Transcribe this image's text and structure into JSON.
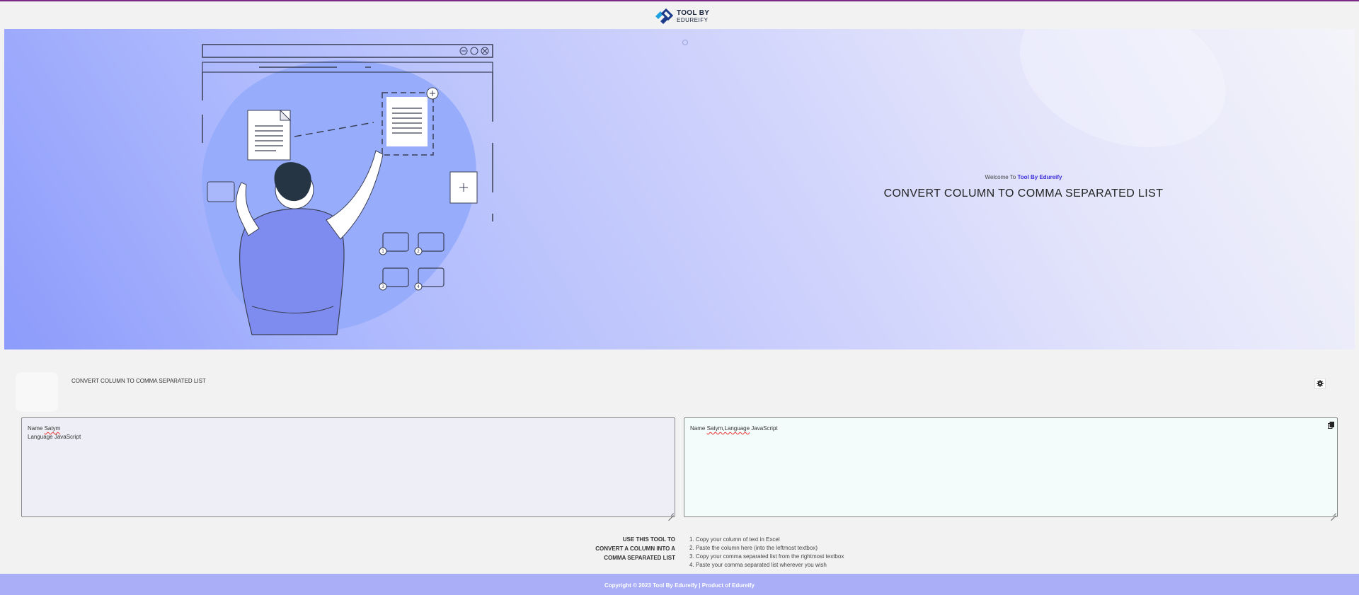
{
  "header": {
    "logo_line1": "TOOL BY",
    "logo_line2": "EDUREIFY"
  },
  "hero": {
    "welcome_prefix": "Welcome To ",
    "welcome_brand": "Tool By Edureify",
    "title": "CONVERT COLUMN TO COMMA SEPARATED LIST",
    "illustration_folder_numbers": [
      "1",
      "2",
      "3",
      "4"
    ]
  },
  "tool": {
    "section_label": "CONVERT COLUMN TO COMMA SEPARATED LIST",
    "input_line1_prefix": "Name ",
    "input_line1_word": "Satym",
    "input_line2": "Language JavaScript",
    "output_prefix": "Name ",
    "output_word": "Satym,Language",
    "output_suffix": " JavaScript",
    "settings_icon": "gear-icon",
    "copy_icon": "copy-icon"
  },
  "instructions": {
    "title_lines": [
      "USE THIS TOOL TO",
      "CONVERT A COLUMN INTO A",
      "COMMA SEPARATED LIST"
    ],
    "steps": [
      "1. Copy your column of text in Excel",
      "2. Paste the column here (into the leftmost textbox)",
      "3. Copy your comma separated list from the rightmost textbox",
      "4. Paste your comma separated list wherever you wish"
    ]
  },
  "footer": {
    "text": "Copyright © 2023 Tool By Edureify | Product of Edureify"
  },
  "colors": {
    "top_border": "#7b2a86",
    "brand_blue": "#3a2fd6",
    "footer_bg": "#a9aef6",
    "hero_gradient_start": "#8d9bfb",
    "hero_gradient_end": "#f4f4fa"
  }
}
